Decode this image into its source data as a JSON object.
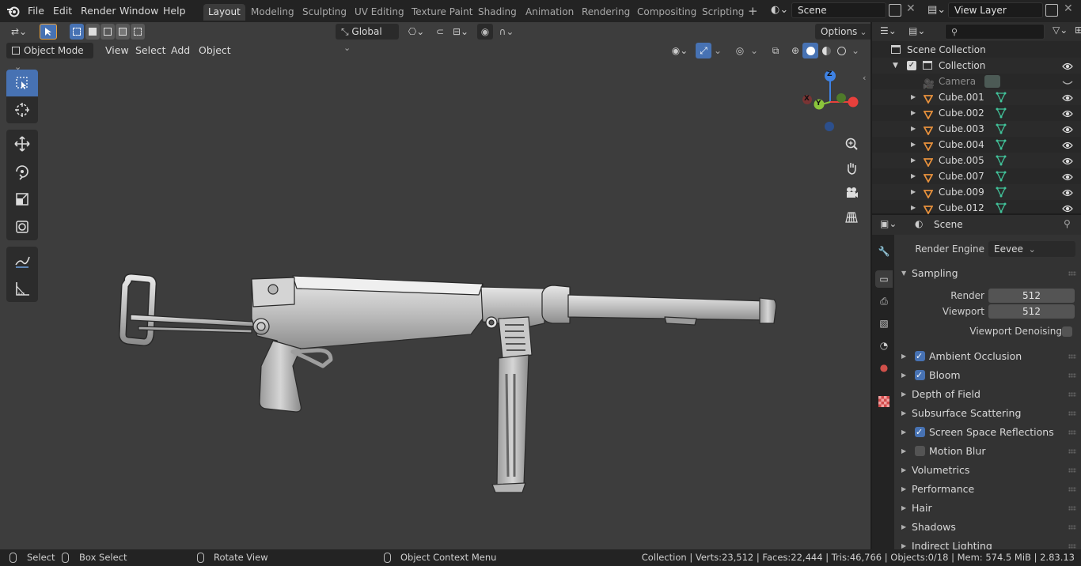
{
  "menubar": {
    "items": [
      "File",
      "Edit",
      "Render",
      "Window",
      "Help"
    ],
    "workspaces": [
      "Layout",
      "Modeling",
      "Sculpting",
      "UV Editing",
      "Texture Paint",
      "Shading",
      "Animation",
      "Rendering",
      "Compositing",
      "Scripting"
    ],
    "active_workspace": "Layout",
    "scene_name": "Scene",
    "view_layer": "View Layer"
  },
  "viewport": {
    "transform_orientation": "Global",
    "options_label": "Options",
    "mode": "Object Mode",
    "menus": [
      "View",
      "Select",
      "Add",
      "Object"
    ],
    "gizmo_axes": [
      "Z",
      "X",
      "Y"
    ],
    "axis_colors": {
      "x": "#e8403c",
      "y": "#8bc53b",
      "z": "#3e82e4"
    }
  },
  "outliner": {
    "search_placeholder": "",
    "root": "Scene Collection",
    "collection": "Collection",
    "items": [
      {
        "name": "Camera",
        "type": "camera",
        "hidden": true
      },
      {
        "name": "Cube.001",
        "type": "mesh",
        "hidden": false
      },
      {
        "name": "Cube.002",
        "type": "mesh",
        "hidden": false
      },
      {
        "name": "Cube.003",
        "type": "mesh",
        "hidden": false
      },
      {
        "name": "Cube.004",
        "type": "mesh",
        "hidden": false
      },
      {
        "name": "Cube.005",
        "type": "mesh",
        "hidden": false
      },
      {
        "name": "Cube.007",
        "type": "mesh",
        "hidden": false
      },
      {
        "name": "Cube.009",
        "type": "mesh",
        "hidden": false
      },
      {
        "name": "Cube.012",
        "type": "mesh",
        "hidden": false
      }
    ]
  },
  "properties": {
    "context": "Scene",
    "render_engine_label": "Render Engine",
    "render_engine": "Eevee",
    "sampling": {
      "title": "Sampling",
      "render_label": "Render",
      "render_value": "512",
      "viewport_label": "Viewport",
      "viewport_value": "512",
      "denoise_label": "Viewport Denoising"
    },
    "panels": [
      {
        "label": "Ambient Occlusion",
        "checkbox": true
      },
      {
        "label": "Bloom",
        "checkbox": true
      },
      {
        "label": "Depth of Field",
        "checkbox": null
      },
      {
        "label": "Subsurface Scattering",
        "checkbox": null
      },
      {
        "label": "Screen Space Reflections",
        "checkbox": true
      },
      {
        "label": "Motion Blur",
        "checkbox": false
      },
      {
        "label": "Volumetrics",
        "checkbox": null
      },
      {
        "label": "Performance",
        "checkbox": null
      },
      {
        "label": "Hair",
        "checkbox": null
      },
      {
        "label": "Shadows",
        "checkbox": null
      },
      {
        "label": "Indirect Lighting",
        "checkbox": null
      }
    ]
  },
  "statusbar": {
    "select": "Select",
    "box_select": "Box Select",
    "rotate_view": "Rotate View",
    "context_menu": "Object Context Menu",
    "stats": "Collection | Verts:23,512 | Faces:22,444 | Tris:46,766 | Objects:0/18 | Mem: 574.5 MiB | 2.83.13"
  }
}
